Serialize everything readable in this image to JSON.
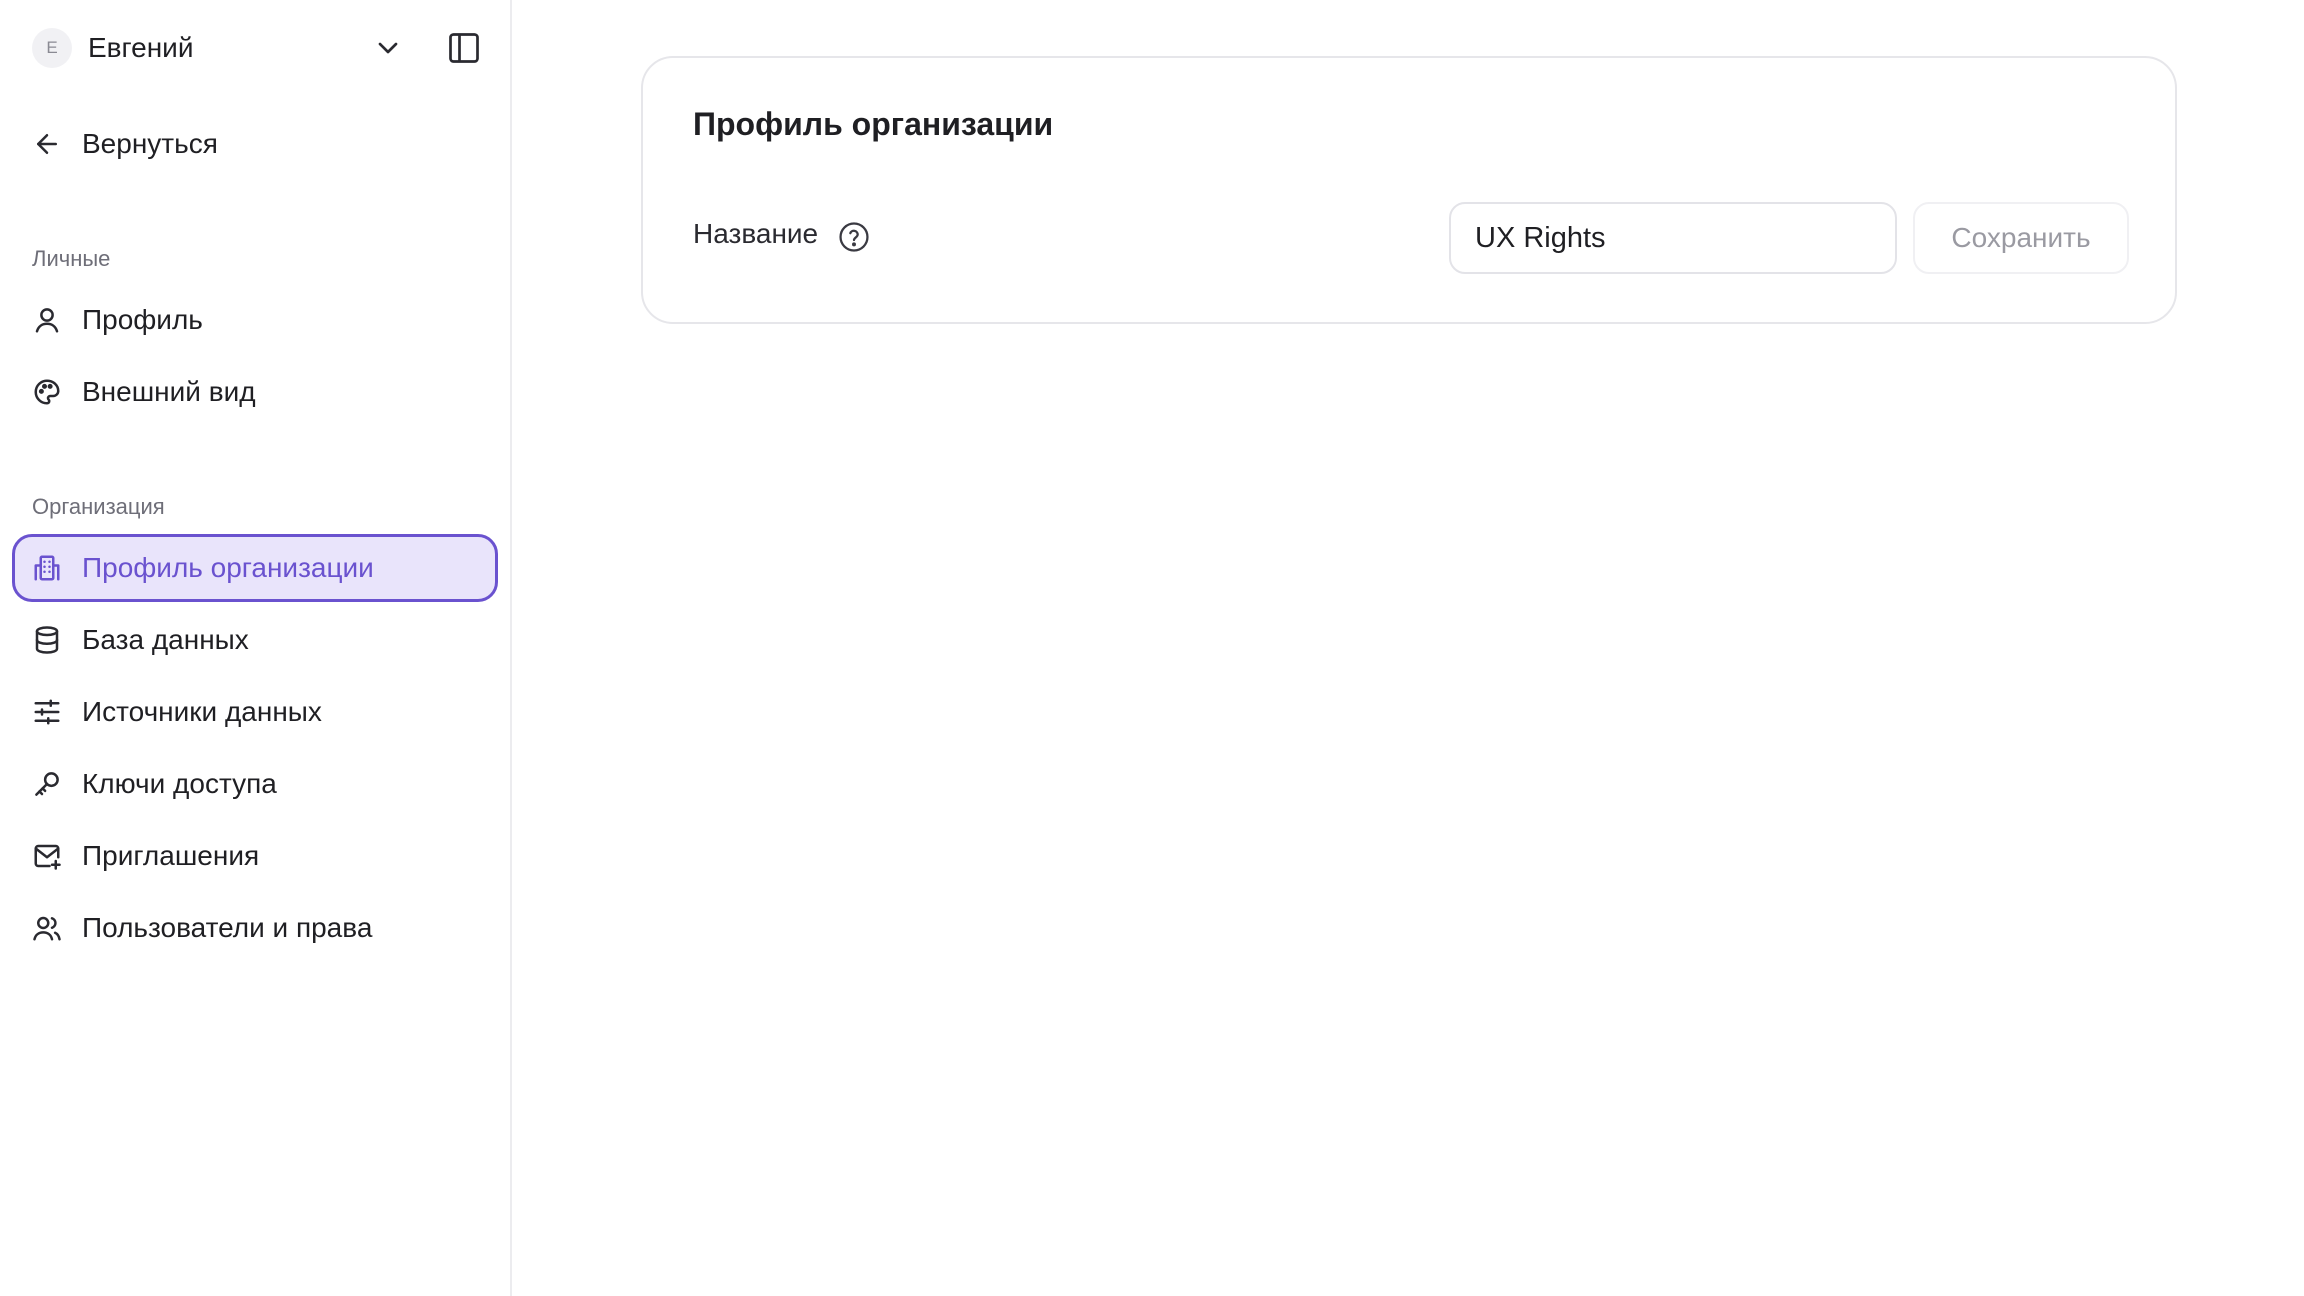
{
  "user": {
    "avatar_letter": "E",
    "name": "Евгений"
  },
  "back": {
    "label": "Вернуться"
  },
  "sections": {
    "personal": "Личные",
    "organization": "Организация"
  },
  "nav": {
    "personal": [
      {
        "label": "Профиль",
        "icon": "user-icon"
      },
      {
        "label": "Внешний вид",
        "icon": "palette-icon"
      }
    ],
    "organization": [
      {
        "label": "Профиль организации",
        "icon": "building-icon",
        "active": true
      },
      {
        "label": "База данных",
        "icon": "database-icon"
      },
      {
        "label": "Источники данных",
        "icon": "sliders-icon"
      },
      {
        "label": "Ключи доступа",
        "icon": "key-icon"
      },
      {
        "label": "Приглашения",
        "icon": "mail-plus-icon"
      },
      {
        "label": "Пользователи и права",
        "icon": "users-icon"
      }
    ]
  },
  "main": {
    "card_title": "Профиль организации",
    "name_field": {
      "label": "Название",
      "value": "UX Rights"
    },
    "save_label": "Сохранить"
  },
  "colors": {
    "accent": "#6a52cf",
    "accent_bg": "#e9e4fb",
    "border": "#e6e6ea",
    "muted_text": "#6e6e78"
  }
}
